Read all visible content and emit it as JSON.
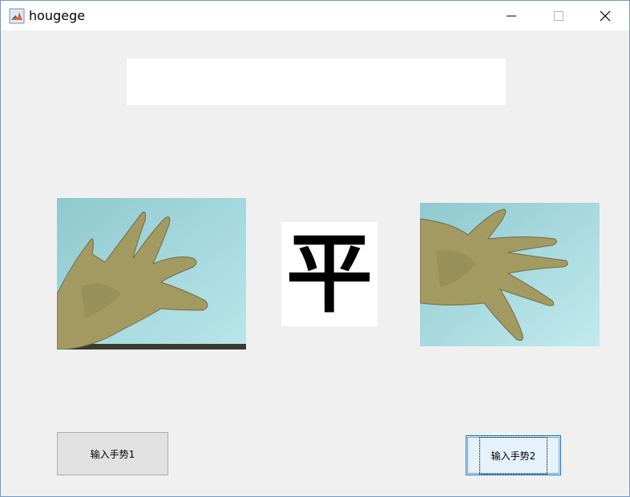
{
  "window": {
    "title": "hougege"
  },
  "title_controls": {
    "minimize_glyph": "—",
    "maximize_glyph": "☐",
    "close_glyph": "✕"
  },
  "result": {
    "char": "平",
    "text_display": ""
  },
  "gesture_images": {
    "left": {
      "icon": "hand-photo-icon"
    },
    "right": {
      "icon": "hand-photo-icon"
    }
  },
  "buttons": {
    "input1_label": "输入手势1",
    "input2_label": "输入手势2"
  },
  "colors": {
    "accent": "#0078d7",
    "background": "#f0f0f0"
  }
}
